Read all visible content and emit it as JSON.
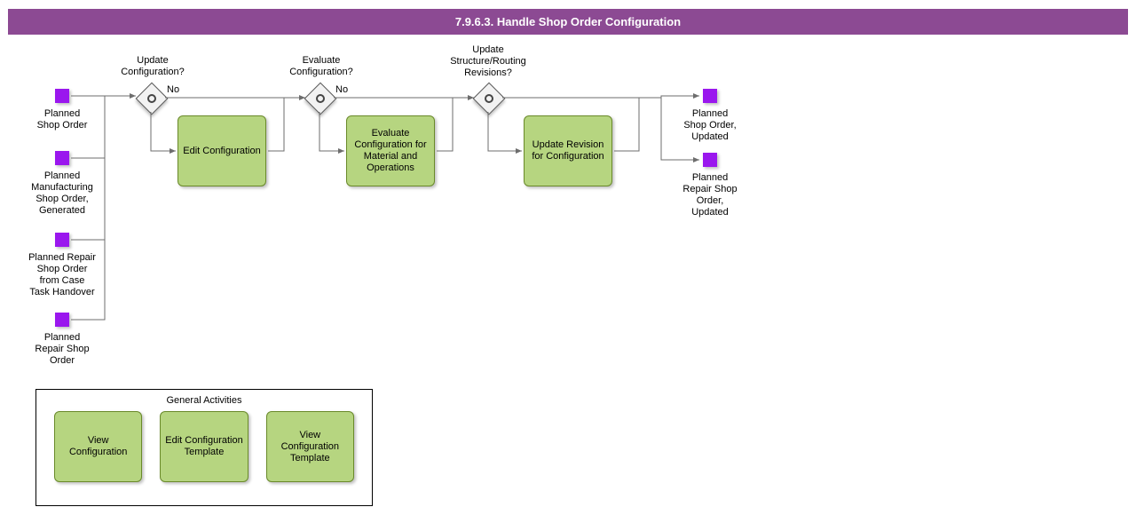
{
  "title": "7.9.6.3. Handle Shop Order Configuration",
  "events": {
    "start1": "Planned\nShop Order",
    "start2": "Planned\nManufacturing\nShop Order,\nGenerated",
    "start3": "Planned Repair\nShop Order\nfrom Case\nTask Handover",
    "start4": "Planned\nRepair Shop\nOrder",
    "end1": "Planned\nShop Order,\nUpdated",
    "end2": "Planned\nRepair Shop\nOrder,\nUpdated"
  },
  "gateways": {
    "gw1": "Update\nConfiguration?",
    "gw2": "Evaluate\nConfiguration?",
    "gw3": "Update\nStructure/Routing\nRevisions?",
    "no": "No"
  },
  "tasks": {
    "task1": "Edit Configuration",
    "task2": "Evaluate Configuration for Material and Operations",
    "task3": "Update Revision for Configuration"
  },
  "general": {
    "title": "General Activities",
    "t1": "View Configuration",
    "t2": "Edit Configuration Template",
    "t3": "View Configuration Template"
  }
}
